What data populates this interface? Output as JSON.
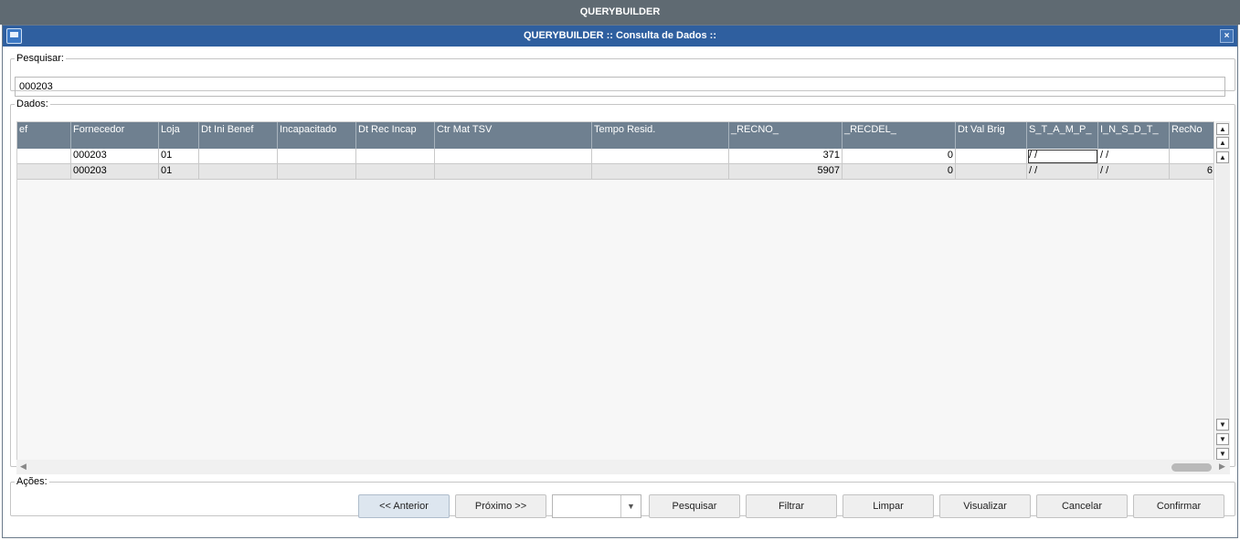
{
  "app_title": "QUERYBUILDER",
  "window": {
    "title": "QUERYBUILDER :: Consulta de Dados ::",
    "close_glyph": "×"
  },
  "search": {
    "legend": "Pesquisar:",
    "value": "000203"
  },
  "data_section": {
    "legend": "Dados:",
    "columns": [
      "ef",
      "Fornecedor",
      "Loja",
      "Dt Ini Benef",
      "Incapacitado",
      "Dt Rec Incap",
      "Ctr Mat TSV",
      "Tempo Resid.",
      "_RECNO_",
      "_RECDEL_",
      "Dt Val Brig",
      "S_T_A_M_P_",
      "I_N_S_D_T_",
      "RecNo"
    ],
    "rows": [
      [
        "",
        "000203",
        "01",
        "",
        "",
        "",
        "",
        "",
        "371",
        "0",
        "",
        " / /",
        " / /",
        ""
      ],
      [
        "",
        "000203",
        "01",
        "",
        "",
        "",
        "",
        "",
        "5907",
        "0",
        "",
        " / /",
        " / /",
        "6"
      ]
    ]
  },
  "actions": {
    "legend": "Ações:",
    "prev": "<< Anterior",
    "next": "Próximo >>",
    "combo_value": "",
    "search": "Pesquisar",
    "filter": "Filtrar",
    "clear": "Limpar",
    "view": "Visualizar",
    "cancel": "Cancelar",
    "confirm": "Confirmar"
  }
}
